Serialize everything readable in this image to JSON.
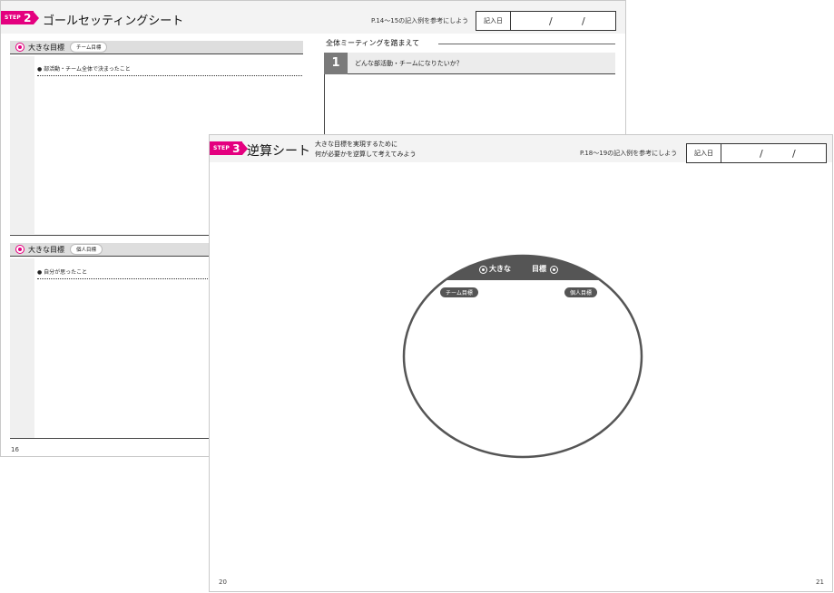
{
  "back_page": {
    "step_label": "STEP",
    "step_number": "2",
    "title": "ゴールセッティングシート",
    "reference": "P.14〜15の記入例を参考にしよう",
    "date_label": "記入日",
    "date_sep1": "/",
    "date_sep2": "/",
    "section1": {
      "title": "大きな目標",
      "tag": "チーム目標",
      "bullet": "● 部活動・チーム全体で決まったこと"
    },
    "section2": {
      "title": "大きな目標",
      "tag": "個人目標",
      "bullet": "● 自分が思ったこと"
    },
    "right_heading": "全体ミーティングを踏まえて",
    "question_number": "1",
    "question_text": "どんな部活動・チームになりたいか？",
    "page_number": "16"
  },
  "front_page": {
    "step_label": "STEP",
    "step_number": "3",
    "title": "逆算シート",
    "subtitle_line1": "大きな目標を実現するために",
    "subtitle_line2": "何が必要かを逆算して考えてみよう",
    "reference": "P.18〜19の記入例を参考にしよう",
    "date_label": "記入日",
    "date_sep1": "/",
    "date_sep2": "/",
    "oval_title_left": "大きな",
    "oval_title_right": "目標",
    "oval_tag_team": "チーム目標",
    "oval_tag_personal": "個人目標",
    "page_number_left": "20",
    "page_number_right": "21"
  },
  "colors": {
    "accent": "#e4007f",
    "dark_gray": "#555555",
    "band_gray": "#dedede"
  }
}
